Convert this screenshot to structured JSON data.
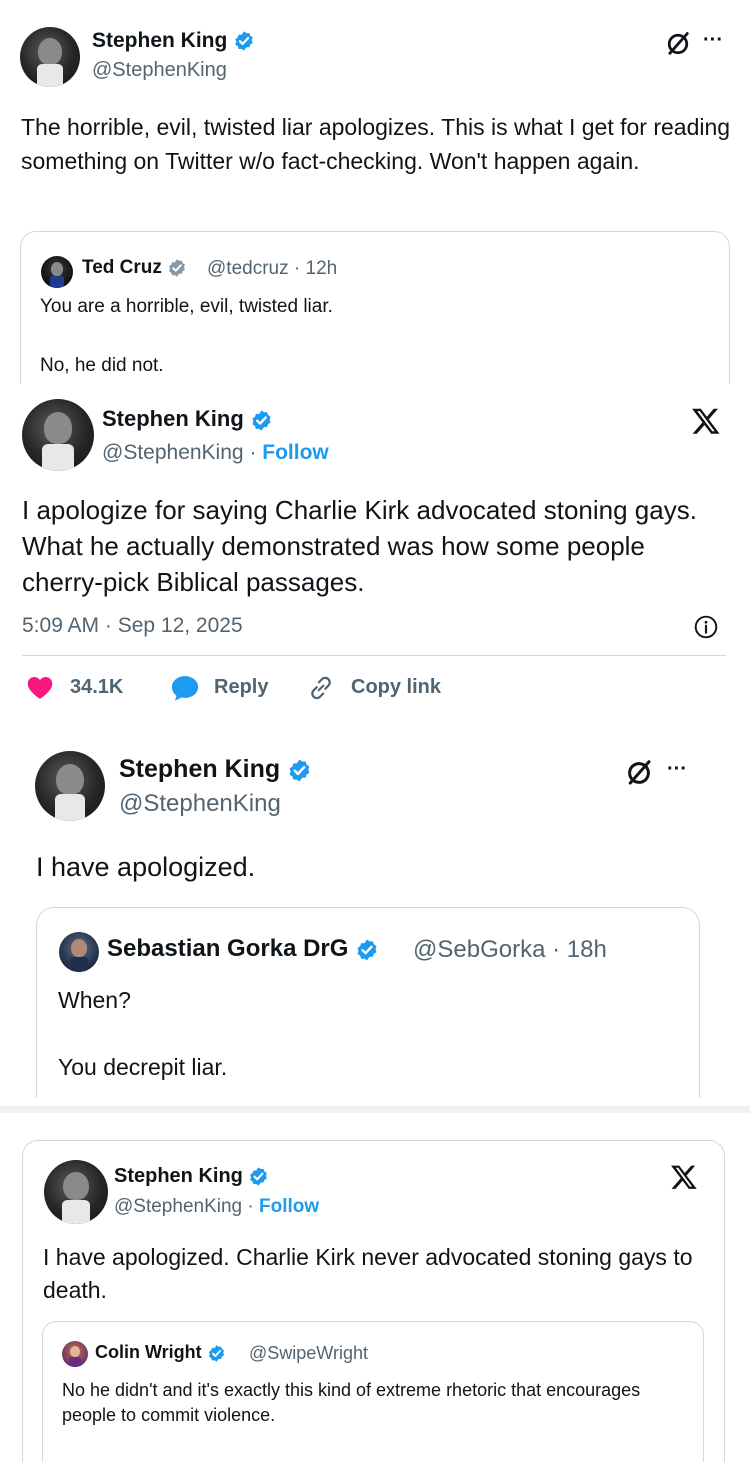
{
  "post1": {
    "author_name": "Stephen King",
    "author_handle": "@StephenKing",
    "text": "The horrible, evil, twisted liar apologizes. This is what I get for reading something on Twitter w/o fact-checking. Won't happen again.",
    "more_label": "···",
    "quote": {
      "author_name": "Ted Cruz",
      "author_handle": "@tedcruz",
      "time": "· 12h",
      "line1": "You are a horrible, evil, twisted liar.",
      "line2": "No, he did not."
    }
  },
  "post2": {
    "author_name": "Stephen King",
    "author_handle": "@StephenKing",
    "separator": "·",
    "follow_label": "Follow",
    "text": "I apologize for saying Charlie Kirk advocated stoning gays. What he actually demonstrated was how some people cherry-pick Biblical passages.",
    "timestamp": "5:09 AM · Sep 12, 2025",
    "likes": "34.1K",
    "reply_label": "Reply",
    "copy_label": "Copy link"
  },
  "post3": {
    "author_name": "Stephen King",
    "author_handle": "@StephenKing",
    "text": "I have apologized.",
    "more_label": "···",
    "quote": {
      "author_name": "Sebastian Gorka DrG",
      "author_handle": "@SebGorka",
      "time": "· 18h",
      "line1": "When?",
      "line2": "You decrepit liar."
    }
  },
  "post4": {
    "author_name": "Stephen King",
    "author_handle": "@StephenKing",
    "separator": "·",
    "follow_label": "Follow",
    "text": "I have apologized. Charlie Kirk never advocated stoning gays to death.",
    "quote": {
      "author_name": "Colin Wright",
      "author_handle": "@SwipeWright",
      "text": "No he didn't and it's exactly this kind of extreme rhetoric that encourages people to commit violence."
    }
  },
  "colors": {
    "verified": "#1d9bf0",
    "follow": "#1d9bf0",
    "like": "#f91880",
    "reply": "#1d9bf0"
  },
  "icons": [
    "verified-badge-icon",
    "grok-icon",
    "more-icon",
    "x-logo-icon",
    "info-icon",
    "heart-icon",
    "reply-bubble-icon",
    "link-icon"
  ]
}
